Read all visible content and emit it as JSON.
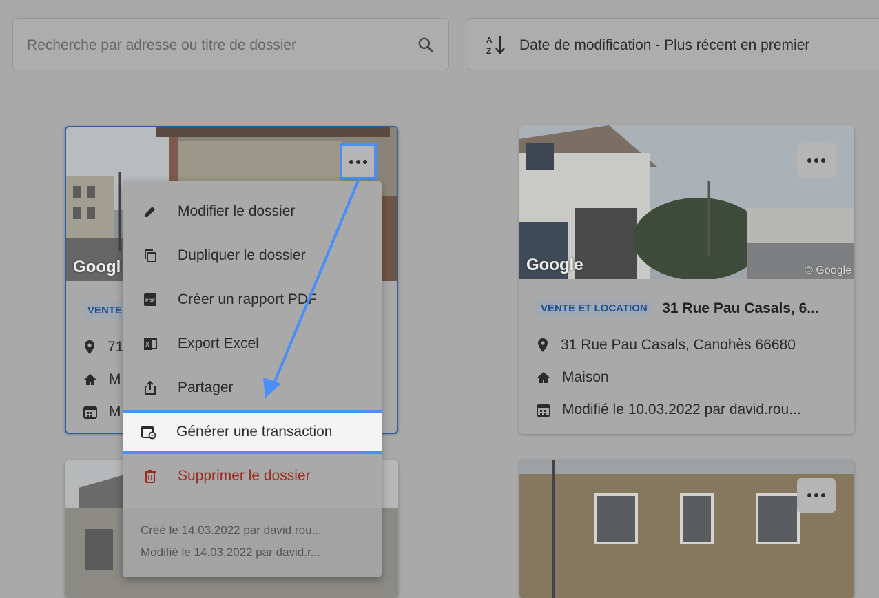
{
  "search": {
    "placeholder": "Recherche par adresse ou titre de dossier"
  },
  "sort": {
    "label": "Date de modification - Plus récent en premier"
  },
  "cards": [
    {
      "badge": "VENTE",
      "title": "",
      "address": "71",
      "type": "M",
      "modified": "M",
      "photo_mark": "Googl"
    },
    {
      "badge": "VENTE ET LOCATION",
      "title": "31 Rue Pau Casals, 6...",
      "address": "31 Rue Pau Casals, Canohès 66680",
      "type": "Maison",
      "modified": "Modifié le 10.03.2022 par david.rou...",
      "photo_mark": "Google",
      "photo_copy": "© Google"
    }
  ],
  "menu": {
    "items": [
      {
        "label": "Modifier le dossier",
        "icon": "pencil-icon"
      },
      {
        "label": "Dupliquer le dossier",
        "icon": "copy-icon"
      },
      {
        "label": "Créer un rapport PDF",
        "icon": "pdf-icon"
      },
      {
        "label": "Export Excel",
        "icon": "excel-icon"
      },
      {
        "label": "Partager",
        "icon": "share-icon"
      },
      {
        "label": "Générer une transaction",
        "icon": "calendar-sync-icon"
      },
      {
        "label": "Supprimer le dossier",
        "icon": "trash-icon"
      }
    ],
    "created": "Créé le 14.03.2022 par david.rou...",
    "modified": "Modifié le 14.03.2022 par david.r..."
  },
  "colors": {
    "highlight": "#4a8ff7",
    "danger": "#9b2b1e",
    "badge_text": "#1d4f93"
  }
}
